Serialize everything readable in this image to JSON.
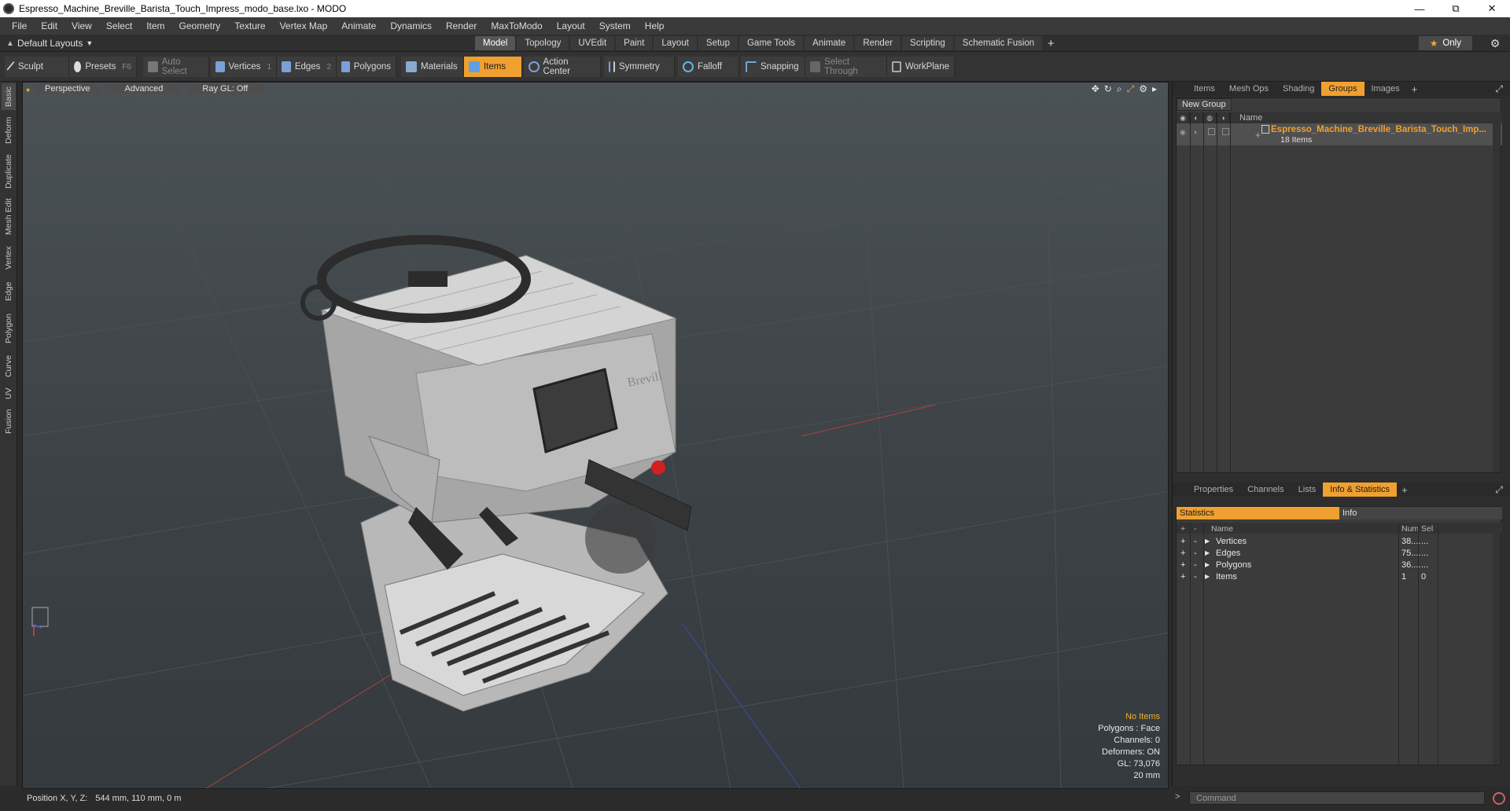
{
  "window": {
    "title": "Espresso_Machine_Breville_Barista_Touch_Impress_modo_base.lxo - MODO",
    "minimize": "—",
    "maximize": "⧉",
    "close": "✕"
  },
  "menu": [
    "File",
    "Edit",
    "View",
    "Select",
    "Item",
    "Geometry",
    "Texture",
    "Vertex Map",
    "Animate",
    "Dynamics",
    "Render",
    "MaxToModo",
    "Layout",
    "System",
    "Help"
  ],
  "layout": {
    "selector": "Default Layouts",
    "tabs": [
      "Model",
      "Topology",
      "UVEdit",
      "Paint",
      "Layout",
      "Setup",
      "Game Tools",
      "Animate",
      "Render",
      "Scripting",
      "Schematic Fusion"
    ],
    "active_tab": "Model",
    "add": "+",
    "only": "Only"
  },
  "toolbar": {
    "sculpt": "Sculpt",
    "presets": "Presets",
    "presets_key": "F6",
    "auto_select": "Auto Select",
    "vertices": "Vertices",
    "vertices_key": "1",
    "edges": "Edges",
    "edges_key": "2",
    "polygons": "Polygons",
    "materials": "Materials",
    "items": "Items",
    "action_center": "Action Center",
    "symmetry": "Symmetry",
    "falloff": "Falloff",
    "snapping": "Snapping",
    "select_through": "Select Through",
    "workplane": "WorkPlane"
  },
  "left_tabs": [
    "Basic",
    "Deform",
    "Duplicate",
    "Mesh Edit",
    "Vertex",
    "Edge",
    "Polygon",
    "Curve",
    "UV",
    "Fusion"
  ],
  "viewport": {
    "view": "Perspective",
    "shading": "Advanced",
    "raygl": "Ray GL: Off",
    "stats": {
      "selection": "No Items",
      "polygons": "Polygons : Face",
      "channels": "Channels: 0",
      "deformers": "Deformers: ON",
      "gl": "GL: 73,076",
      "grid": "20 mm"
    },
    "brand_text": "Brevill"
  },
  "groups_panel": {
    "tabs": [
      "Items",
      "Mesh Ops",
      "Shading",
      "Groups",
      "Images"
    ],
    "active": "Groups",
    "add": "+",
    "new_group": "New Group",
    "col_name": "Name",
    "row": {
      "name": "Espresso_Machine_Breville_Barista_Touch_Imp...",
      "count": "18 Items"
    }
  },
  "info_panel": {
    "tabs": [
      "Properties",
      "Channels",
      "Lists",
      "Info & Statistics"
    ],
    "active": "Info & Statistics",
    "add": "+",
    "subtabs": [
      "Statistics",
      "Info"
    ],
    "headers": {
      "name": "Name",
      "num": "Num",
      "sel": "Sel"
    },
    "rows": [
      {
        "name": "Vertices",
        "num": "38....",
        "sel": "..."
      },
      {
        "name": "Edges",
        "num": "75....",
        "sel": "..."
      },
      {
        "name": "Polygons",
        "num": "36....",
        "sel": "..."
      },
      {
        "name": "Items",
        "num": "1",
        "sel": "0"
      }
    ]
  },
  "status": {
    "label": "Position X, Y, Z:",
    "value": "544 mm, 110 mm, 0 m"
  },
  "command": {
    "prompt": ">",
    "placeholder": "Command"
  }
}
